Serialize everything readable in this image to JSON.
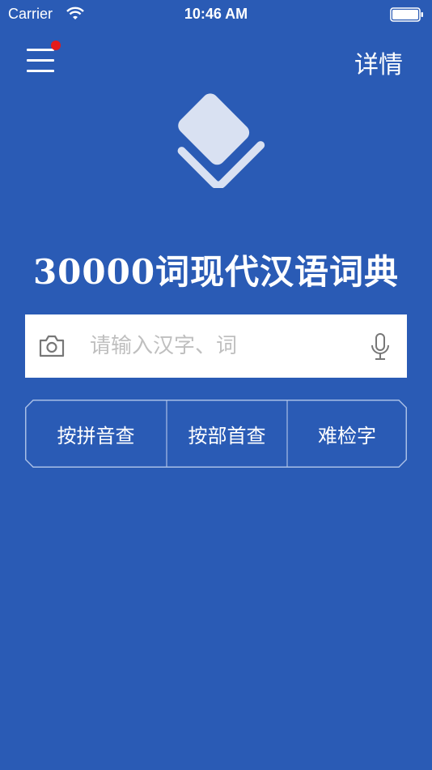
{
  "status_bar": {
    "carrier": "Carrier",
    "time": "10:46 AM"
  },
  "header": {
    "details_label": "详情"
  },
  "app_title": "30000词现代汉语词典",
  "search": {
    "placeholder": "请输入汉字、词",
    "value": ""
  },
  "lookup_buttons": [
    {
      "label": "按拼音查"
    },
    {
      "label": "按部首查"
    },
    {
      "label": "难检字"
    }
  ],
  "colors": {
    "background": "#2a5bb5",
    "badge": "#e51b1b",
    "logo": "#d9e1f2"
  },
  "icons": [
    "wifi-icon",
    "battery-icon",
    "menu-icon",
    "book-logo-icon",
    "camera-icon",
    "microphone-icon"
  ]
}
